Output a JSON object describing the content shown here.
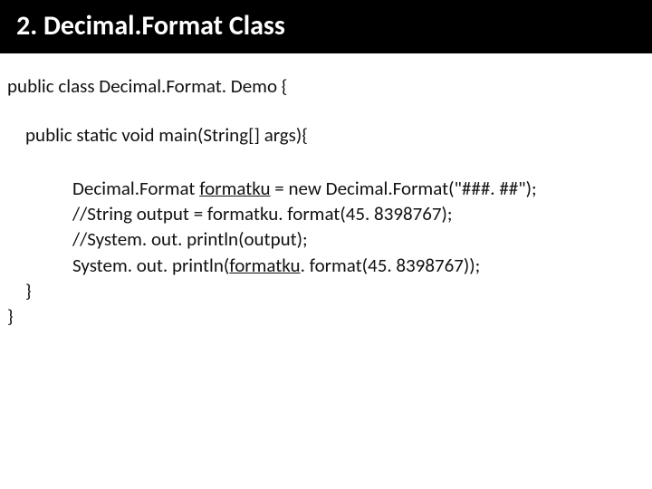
{
  "title": "2. Decimal.Format Class",
  "code": {
    "l1": "public class Decimal.Format. Demo {",
    "l2": "public static void main(String[] args){",
    "l3a": "Decimal.Format ",
    "l3b": "formatku",
    "l3c": " = new Decimal.Format(\"###. ##\");",
    "l4": "//String output = formatku. format(45. 8398767);",
    "l5": "//System. out. println(output);",
    "l6a": "System. out. println(",
    "l6b": "formatku",
    "l6c": ". format(45. 8398767));",
    "l7": "}",
    "l8": "}"
  }
}
